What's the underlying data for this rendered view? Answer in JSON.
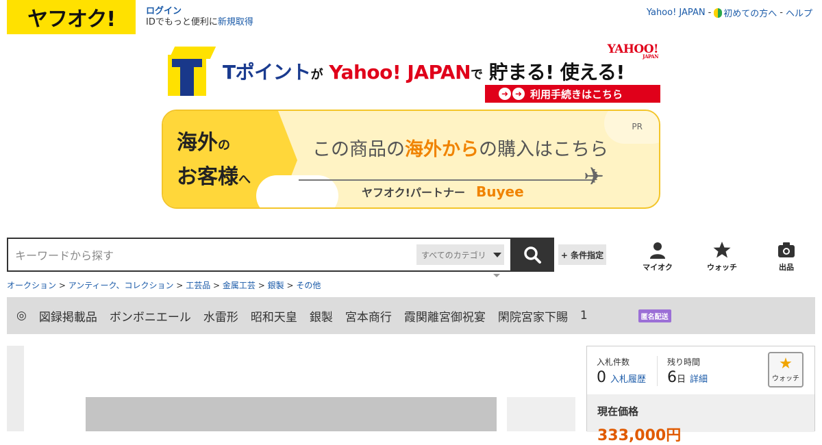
{
  "header": {
    "logo_text": "ヤフオク!",
    "login_label": "ログイン",
    "id_text": "IDでもっと便利に",
    "register_label": "新規取得",
    "links": {
      "yahoo_japan": "Yahoo! JAPAN",
      "sep1": "-",
      "beginners": "初めての方へ",
      "sep2": "-",
      "help": "ヘルプ"
    }
  },
  "tpoint_banner": {
    "t_point": "Tポイント",
    "ga": "が",
    "yahoo_japan": "Yahoo! JAPAN",
    "de": "で",
    "save_use": "貯まる! 使える!",
    "yahoo_logo": "YAHOO!",
    "yahoo_logo_sub": "JAPAN",
    "cta": "利用手続きはこちら"
  },
  "overseas_banner": {
    "left_line1_a": "海外",
    "left_line1_b": "の",
    "left_line2_a": "お客様",
    "left_line2_b": "へ",
    "main_a": "この商品の",
    "main_b": "海外から",
    "main_c": "の購入はこちら",
    "pr": "PR",
    "partner": "ヤフオク!パートナー",
    "buyee": "Buyee"
  },
  "search": {
    "placeholder": "キーワードから探す",
    "category": "すべてのカテゴリ",
    "condition_button": "+ 条件指定"
  },
  "nav": {
    "my_auction": "マイオク",
    "watch": "ウォッチ",
    "sell": "出品"
  },
  "breadcrumb": [
    "オークション",
    "アンティーク、コレクション",
    "工芸品",
    "金属工芸",
    "銀製",
    "その他"
  ],
  "breadcrumb_sep": ">",
  "tags": [
    "◎",
    "図録掲載品",
    "ボンボニエール",
    "水雷形",
    "昭和天皇",
    "銀製",
    "宮本商行",
    "霞関離宮御祝宴",
    "閑院宮家下賜",
    "1"
  ],
  "tag_badge": "匿名配送",
  "bid_panel": {
    "bids_label": "入札件数",
    "bids_value": "0",
    "bid_history": "入札履歴",
    "time_label": "残り時間",
    "time_value": "6",
    "time_unit": "日",
    "detail": "詳細",
    "watch_label": "ウォッチ",
    "price_label": "現在価格",
    "price_value": "333,000円"
  },
  "colors": {
    "logo_bg": "#ffe100",
    "link": "#1a5aa8",
    "tpoint_red": "#e0001a",
    "tpoint_blue": "#1a3b8f",
    "overseas_orange": "#f08300",
    "badge_purple": "#9b6fd6",
    "price": "#e05a00"
  }
}
